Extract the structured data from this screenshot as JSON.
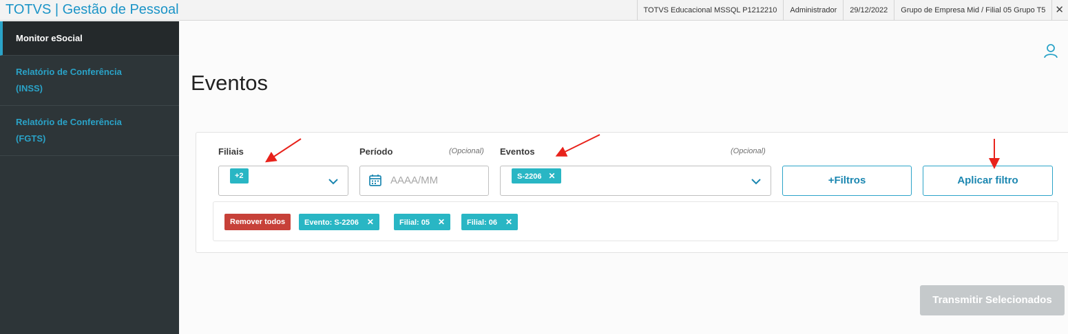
{
  "app": {
    "title": "TOTVS | Gestão de Pessoal"
  },
  "topbar": {
    "environment": "TOTVS Educacional MSSQL P1212210",
    "user": "Administrador",
    "date": "29/12/2022",
    "company": "Grupo de Empresa Mid / Filial 05 Grupo T5",
    "close_label": "✕"
  },
  "sidebar": {
    "items": [
      {
        "label": "Monitor eSocial"
      },
      {
        "label_line1": "Relatório de Conferência",
        "label_line2": "(INSS)"
      },
      {
        "label_line1": "Relatório de Conferência",
        "label_line2": "(FGTS)"
      }
    ]
  },
  "main": {
    "title": "Eventos",
    "filters": {
      "filiais": {
        "label": "Filiais",
        "chip": "+2"
      },
      "periodo": {
        "label": "Período",
        "optional": "(Opcional)",
        "placeholder": "AAAA/MM"
      },
      "eventos": {
        "label": "Eventos",
        "optional": "(Opcional)",
        "chip": "S-2206",
        "chip_remove": "✕"
      },
      "more_filters_label": "+Filtros",
      "apply_label": "Aplicar filtro"
    },
    "active_tags": {
      "remove_all_label": "Remover todos",
      "tags": [
        {
          "label": "Evento: S-2206",
          "remove": "✕"
        },
        {
          "label": "Filial: 05",
          "remove": "✕"
        },
        {
          "label": "Filial: 06",
          "remove": "✕"
        }
      ]
    },
    "transmit_label": "Transmitir Selecionados"
  },
  "colors": {
    "brand": "#1b94c7",
    "accent": "#2aa3c8",
    "chip": "#29b6c4",
    "danger": "#c74139",
    "sidebar_bg": "#2d3538",
    "annotation_arrow": "#e8221b"
  }
}
